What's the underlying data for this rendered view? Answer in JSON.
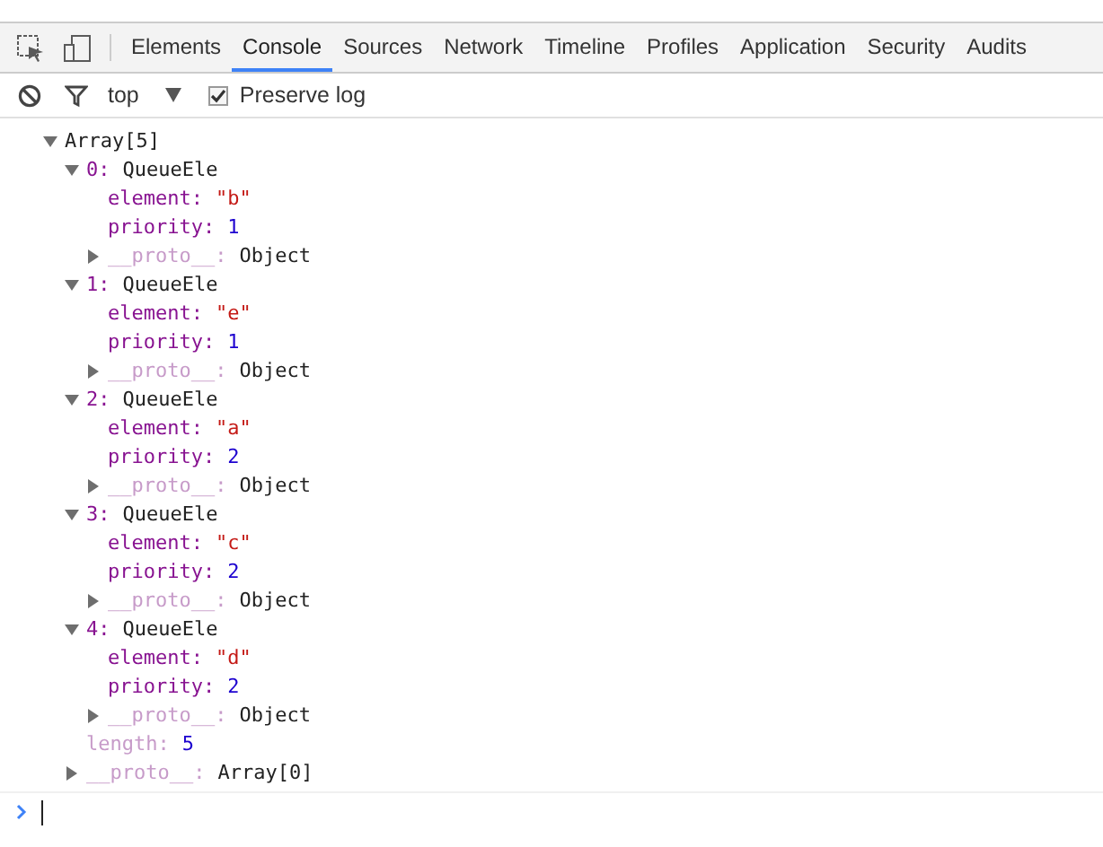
{
  "toolbar": {
    "tabs": [
      {
        "label": "Elements",
        "selected": false
      },
      {
        "label": "Console",
        "selected": true
      },
      {
        "label": "Sources",
        "selected": false
      },
      {
        "label": "Network",
        "selected": false
      },
      {
        "label": "Timeline",
        "selected": false
      },
      {
        "label": "Profiles",
        "selected": false
      },
      {
        "label": "Application",
        "selected": false
      },
      {
        "label": "Security",
        "selected": false
      },
      {
        "label": "Audits",
        "selected": false
      }
    ]
  },
  "console_bar": {
    "context": "top",
    "preserve_log": {
      "label": "Preserve log",
      "checked": true
    }
  },
  "output": [
    {
      "kind": "object",
      "value": "Array[5]",
      "expanded": true,
      "children": [
        {
          "kind": "object",
          "key": "0:",
          "value": "QueueEle",
          "expanded": true,
          "children": [
            {
              "kind": "string",
              "key": "element:",
              "value": "\"b\""
            },
            {
              "kind": "number",
              "key": "priority:",
              "value": "1"
            },
            {
              "kind": "meta_object",
              "key": "__proto__:",
              "value": "Object",
              "expanded": false
            }
          ]
        },
        {
          "kind": "object",
          "key": "1:",
          "value": "QueueEle",
          "expanded": true,
          "children": [
            {
              "kind": "string",
              "key": "element:",
              "value": "\"e\""
            },
            {
              "kind": "number",
              "key": "priority:",
              "value": "1"
            },
            {
              "kind": "meta_object",
              "key": "__proto__:",
              "value": "Object",
              "expanded": false
            }
          ]
        },
        {
          "kind": "object",
          "key": "2:",
          "value": "QueueEle",
          "expanded": true,
          "children": [
            {
              "kind": "string",
              "key": "element:",
              "value": "\"a\""
            },
            {
              "kind": "number",
              "key": "priority:",
              "value": "2"
            },
            {
              "kind": "meta_object",
              "key": "__proto__:",
              "value": "Object",
              "expanded": false
            }
          ]
        },
        {
          "kind": "object",
          "key": "3:",
          "value": "QueueEle",
          "expanded": true,
          "children": [
            {
              "kind": "string",
              "key": "element:",
              "value": "\"c\""
            },
            {
              "kind": "number",
              "key": "priority:",
              "value": "2"
            },
            {
              "kind": "meta_object",
              "key": "__proto__:",
              "value": "Object",
              "expanded": false
            }
          ]
        },
        {
          "kind": "object",
          "key": "4:",
          "value": "QueueEle",
          "expanded": true,
          "children": [
            {
              "kind": "string",
              "key": "element:",
              "value": "\"d\""
            },
            {
              "kind": "number",
              "key": "priority:",
              "value": "2"
            },
            {
              "kind": "meta_object",
              "key": "__proto__:",
              "value": "Object",
              "expanded": false
            }
          ]
        },
        {
          "kind": "meta_number",
          "key": "length:",
          "value": "5"
        },
        {
          "kind": "meta_object",
          "key": "__proto__:",
          "value": "Array[0]",
          "expanded": false
        }
      ]
    }
  ]
}
